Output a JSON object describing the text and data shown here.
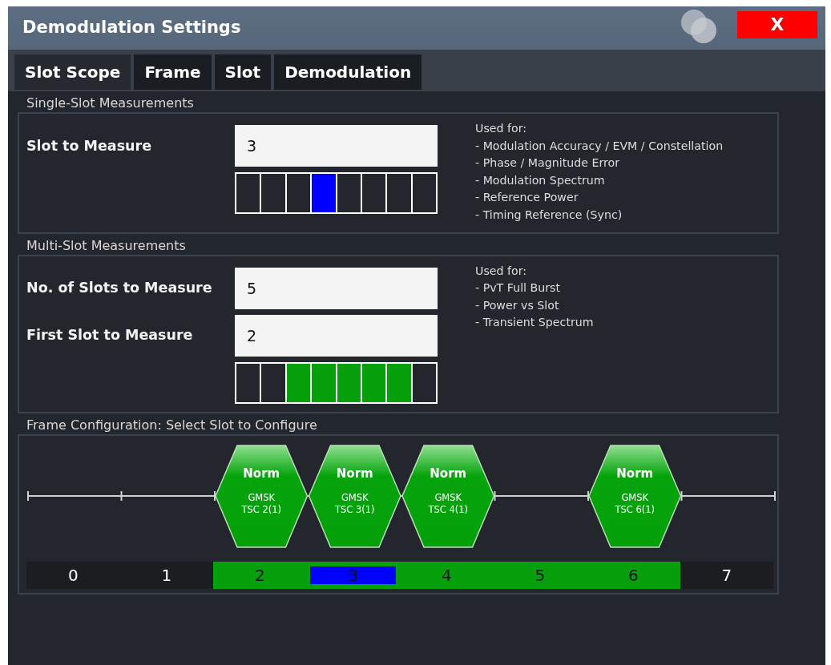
{
  "window": {
    "title": "Demodulation Settings",
    "close_label": "X"
  },
  "tabs": [
    {
      "label": "Slot Scope",
      "selected": true
    },
    {
      "label": "Frame",
      "selected": false
    },
    {
      "label": "Slot",
      "selected": false
    },
    {
      "label": "Demodulation",
      "selected": false
    }
  ],
  "single_slot": {
    "heading": "Single-Slot Measurements",
    "fields": [
      {
        "label": "Slot to Measure",
        "value": "3"
      }
    ],
    "slot_cells": [
      {
        "selected": false
      },
      {
        "selected": false
      },
      {
        "selected": false
      },
      {
        "selected": true
      },
      {
        "selected": false
      },
      {
        "selected": false
      },
      {
        "selected": false
      },
      {
        "selected": false
      }
    ],
    "info": [
      "Used for:",
      "- Modulation Accuracy / EVM / Constellation",
      "- Phase / Magnitude Error",
      "- Modulation Spectrum",
      "- Reference Power",
      "- Timing Reference (Sync)"
    ]
  },
  "multi_slot": {
    "heading": "Multi-Slot Measurements",
    "fields": [
      {
        "label": "No. of Slots to Measure",
        "value": "5"
      },
      {
        "label": "First Slot to Measure",
        "value": "2"
      }
    ],
    "slot_cells": [
      {
        "active": false
      },
      {
        "active": false
      },
      {
        "active": true
      },
      {
        "active": true
      },
      {
        "active": true
      },
      {
        "active": true
      },
      {
        "active": true
      },
      {
        "active": false
      }
    ],
    "info": [
      "Used for:",
      "- PvT Full Burst",
      "- Power vs Slot",
      "- Transient Spectrum"
    ]
  },
  "frame_config": {
    "heading": "Frame Configuration: Select Slot to Configure",
    "slots": [
      {
        "number": "0",
        "kind": "empty",
        "in_range": false,
        "selected": false
      },
      {
        "number": "1",
        "kind": "empty",
        "in_range": false,
        "selected": false
      },
      {
        "number": "2",
        "kind": "burst",
        "burst": "Norm",
        "modulation": "GMSK",
        "tsc": "TSC 2(1)",
        "in_range": true,
        "selected": false
      },
      {
        "number": "3",
        "kind": "burst",
        "burst": "Norm",
        "modulation": "GMSK",
        "tsc": "TSC 3(1)",
        "in_range": true,
        "selected": true
      },
      {
        "number": "4",
        "kind": "burst",
        "burst": "Norm",
        "modulation": "GMSK",
        "tsc": "TSC 4(1)",
        "in_range": true,
        "selected": false
      },
      {
        "number": "5",
        "kind": "empty",
        "in_range": true,
        "selected": false
      },
      {
        "number": "6",
        "kind": "burst",
        "burst": "Norm",
        "modulation": "GMSK",
        "tsc": "TSC 6(1)",
        "in_range": true,
        "selected": false
      },
      {
        "number": "7",
        "kind": "empty",
        "in_range": false,
        "selected": false
      }
    ]
  }
}
